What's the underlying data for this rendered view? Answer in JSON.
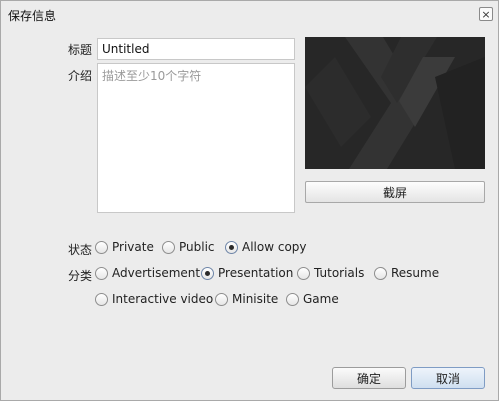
{
  "window": {
    "title": "保存信息",
    "close_glyph": "×"
  },
  "form": {
    "title_label": "标题",
    "title_value": "Untitled",
    "desc_label": "介绍",
    "desc_placeholder": "描述至少10个字符",
    "desc_value": ""
  },
  "preview": {
    "button_label": "截屏"
  },
  "status": {
    "label": "状态",
    "options": [
      {
        "label": "Private",
        "checked": false
      },
      {
        "label": "Public",
        "checked": false
      },
      {
        "label": "Allow copy",
        "checked": true
      }
    ]
  },
  "category": {
    "label": "分类",
    "options": [
      {
        "label": "Advertisement",
        "checked": false
      },
      {
        "label": "Presentation",
        "checked": true
      },
      {
        "label": "Tutorials",
        "checked": false
      },
      {
        "label": "Resume",
        "checked": false
      },
      {
        "label": "Interactive video",
        "checked": false
      },
      {
        "label": "Minisite",
        "checked": false
      },
      {
        "label": "Game",
        "checked": false
      }
    ]
  },
  "footer": {
    "ok_label": "确定",
    "cancel_label": "取消"
  },
  "icons": {
    "close": "close-icon",
    "radio": "radio-icon"
  },
  "colors": {
    "preview_bg": "#262626",
    "accent": "#7f9cc4",
    "window_bg": "#ececec"
  }
}
